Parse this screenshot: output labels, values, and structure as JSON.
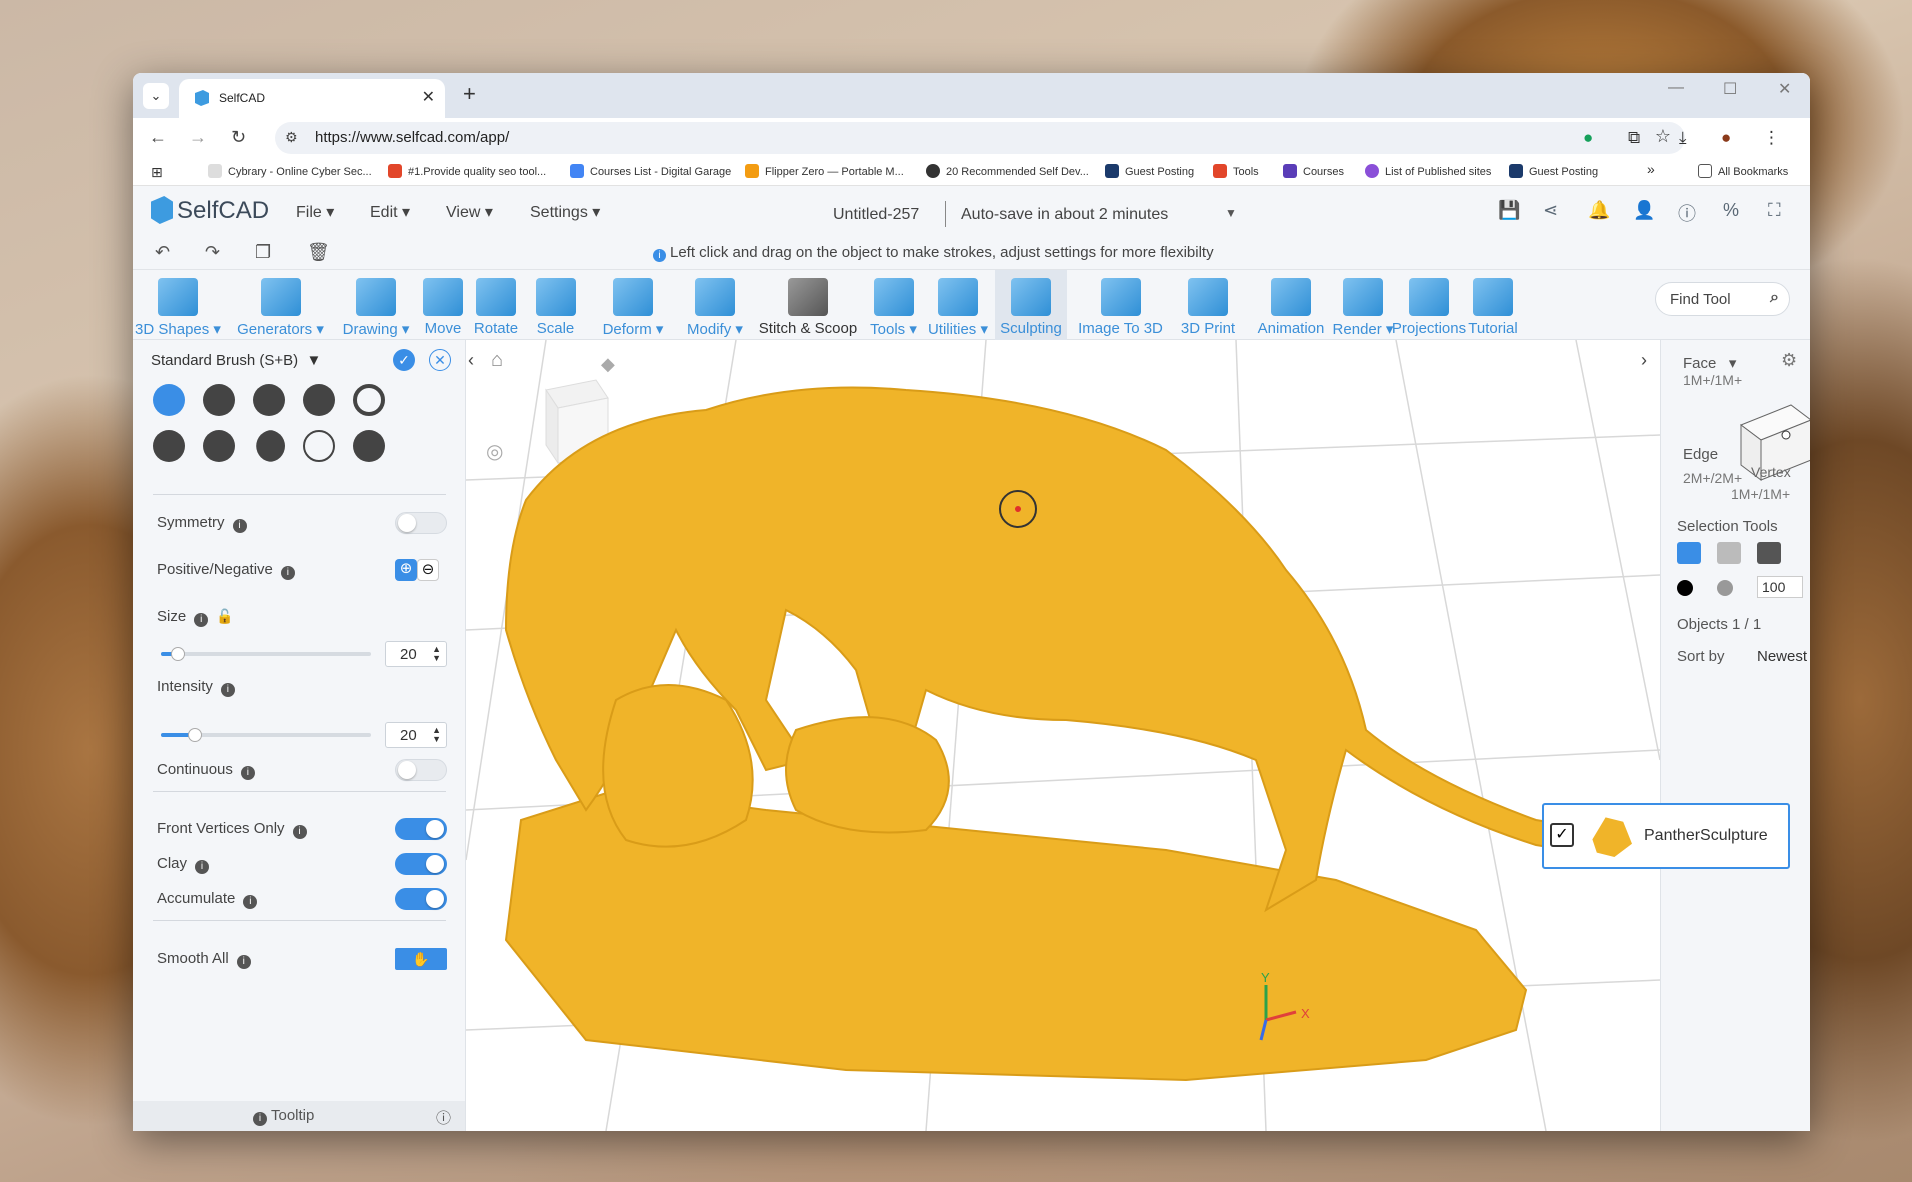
{
  "browser": {
    "tab_title": "SelfCAD",
    "url": "https://www.selfcad.com/app/",
    "bookmarks": [
      "Cybrary - Online Cyber Sec...",
      "#1.Provide quality seo tool...",
      "Courses List - Digital Garage",
      "Flipper Zero — Portable M...",
      "20 Recommended Self Dev...",
      "Guest Posting",
      "Tools",
      "Courses",
      "List of Published sites",
      "Guest Posting"
    ],
    "all_bookmarks": "All Bookmarks",
    "more": "»"
  },
  "app": {
    "logo": "SelfCAD",
    "menus": [
      "File",
      "Edit",
      "View",
      "Settings"
    ],
    "doc_name": "Untitled-257",
    "autosave": "Auto-save in about 2 minutes",
    "hint": "Left click and drag on the object to make strokes, adjust settings for more flexibilty"
  },
  "ribbon": [
    {
      "label": "3D Shapes",
      "dropdown": true
    },
    {
      "label": "Generators",
      "dropdown": true
    },
    {
      "label": "Drawing",
      "dropdown": true
    },
    {
      "label": "Move",
      "dropdown": false
    },
    {
      "label": "Rotate",
      "dropdown": false
    },
    {
      "label": "Scale",
      "dropdown": false
    },
    {
      "label": "Deform",
      "dropdown": true
    },
    {
      "label": "Modify",
      "dropdown": true
    },
    {
      "label": "Stitch & Scoop",
      "dropdown": false
    },
    {
      "label": "Tools",
      "dropdown": true
    },
    {
      "label": "Utilities",
      "dropdown": true
    },
    {
      "label": "Sculpting",
      "dropdown": false
    },
    {
      "label": "Image To 3D",
      "dropdown": false
    },
    {
      "label": "3D Print",
      "dropdown": false
    },
    {
      "label": "Animation",
      "dropdown": false
    },
    {
      "label": "Render",
      "dropdown": true
    },
    {
      "label": "Projections",
      "dropdown": false
    },
    {
      "label": "Tutorial",
      "dropdown": false
    }
  ],
  "find_tool": "Find Tool",
  "left_panel": {
    "brush": "Standard Brush (S+B)",
    "symmetry": "Symmetry",
    "posneg": "Positive/Negative",
    "size_label": "Size",
    "size_value": "20",
    "size_fraction": 0.08,
    "intensity_label": "Intensity",
    "intensity_value": "20",
    "intensity_fraction": 0.16,
    "continuous": "Continuous",
    "front_vertices": "Front Vertices Only",
    "clay": "Clay",
    "accumulate": "Accumulate",
    "smooth_all": "Smooth All",
    "tooltip": "Tooltip"
  },
  "right_panel": {
    "face": "Face",
    "face_keys": "1M+/1M+",
    "edge": "Edge",
    "edge_keys": "2M+/2M+",
    "vertex": "Vertex",
    "vertex_keys": "1M+/1M+",
    "selection_tools": "Selection Tools",
    "opacity": "100",
    "objects": "Objects 1 / 1",
    "sort_by": "Sort by",
    "sort_value": "Newest",
    "object_name": "PantherSculpture"
  },
  "axes": {
    "y": "Y",
    "x": "X"
  },
  "colors": {
    "accent": "#3a8ee6",
    "model": "#f0b429",
    "blue_label": "#3b8fd8"
  }
}
